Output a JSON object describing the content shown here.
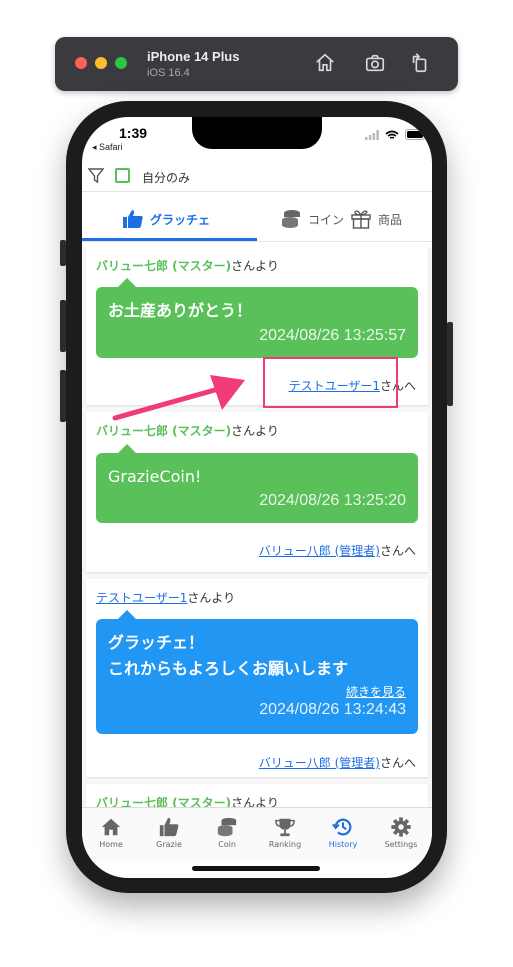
{
  "simulator": {
    "device": "iPhone 14 Plus",
    "os": "iOS 16.4"
  },
  "status_bar": {
    "time": "1:39",
    "back_app": "◂ Safari"
  },
  "filter": {
    "label": "自分のみ"
  },
  "tabs": [
    {
      "label": "グラッチェ",
      "active": true,
      "icon": "thumbs-up-icon"
    },
    {
      "label": "コイン",
      "active": false,
      "icon": "coin-stack-icon"
    },
    {
      "label": "商品",
      "active": false,
      "icon": "gift-icon"
    }
  ],
  "feed": [
    {
      "sender": "バリュー七郎 (マスター)",
      "sender_suffix": "さんより",
      "message_line1": "お土産ありがとう！",
      "message_line2": "",
      "timestamp": "2024/08/26 13:25:57",
      "recipient": "テストユーザー1",
      "recipient_suffix": "さんへ",
      "bubble_color": "#5ac05a"
    },
    {
      "sender": "バリュー七郎 (マスター)",
      "sender_suffix": "さんより",
      "message_line1": "GrazieCoin!",
      "message_line2": "",
      "timestamp": "2024/08/26 13:25:20",
      "recipient": "バリュー八郎 (管理者)",
      "recipient_suffix": "さんへ",
      "bubble_color": "#5ac05a"
    },
    {
      "sender": "テストユーザー1",
      "sender_suffix": "さんより",
      "message_line1": "グラッチェ！",
      "message_line2": "これからもよろしくお願いします",
      "more": "続きを見る",
      "timestamp": "2024/08/26 13:24:43",
      "recipient": "バリュー八郎 (管理者)",
      "recipient_suffix": "さんへ",
      "bubble_color": "#2196f3"
    },
    {
      "sender": "バリュー七郎 (マスター)",
      "sender_suffix": "さんより"
    }
  ],
  "tabbar": [
    {
      "label": "Home",
      "icon": "home-icon"
    },
    {
      "label": "Grazie",
      "icon": "thumbs-up-icon"
    },
    {
      "label": "Coin",
      "icon": "coin-stack-icon"
    },
    {
      "label": "Ranking",
      "icon": "trophy-icon"
    },
    {
      "label": "History",
      "icon": "history-icon",
      "active": true
    },
    {
      "label": "Settings",
      "icon": "gear-icon"
    }
  ],
  "colors": {
    "accent_blue": "#1e6fe3",
    "green": "#5ac05a",
    "annotation_pink": "#f03a7a"
  }
}
